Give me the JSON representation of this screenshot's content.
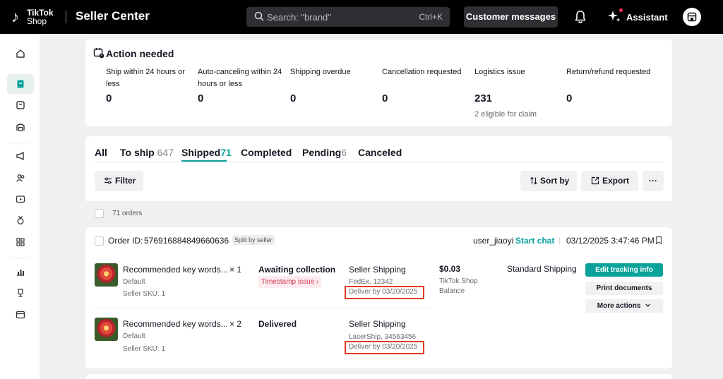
{
  "header": {
    "logo_mark": "♪",
    "logo_text_1": "TikTok",
    "logo_text_2": "Shop",
    "app_title": "Seller Center",
    "search_placeholder": "Search: \"brand\"",
    "search_shortcut": "Ctrl+K",
    "customer_messages": "Customer messages",
    "assistant": "Assistant"
  },
  "sidebar": {
    "items": [
      {
        "icon": "home-icon",
        "active": false
      },
      {
        "icon": "orders-icon",
        "active": true
      },
      {
        "icon": "products-icon",
        "active": false
      },
      {
        "icon": "shipping-icon",
        "active": false
      },
      {
        "icon": "megaphone-icon",
        "active": false
      },
      {
        "icon": "creators-icon",
        "active": false
      },
      {
        "icon": "video-icon",
        "active": false
      },
      {
        "icon": "medal-icon",
        "active": false
      },
      {
        "icon": "apps-icon",
        "active": false
      },
      {
        "icon": "analytics-icon",
        "active": false
      },
      {
        "icon": "trophy-icon",
        "active": false
      },
      {
        "icon": "finance-icon",
        "active": false
      }
    ]
  },
  "action_needed": {
    "title": "Action needed",
    "metrics": [
      {
        "label": "Ship within 24 hours or less",
        "value": "0",
        "sub": ""
      },
      {
        "label": "Auto-canceling within 24 hours or less",
        "value": "0",
        "sub": ""
      },
      {
        "label": "Shipping overdue",
        "value": "0",
        "sub": ""
      },
      {
        "label": "Cancellation requested",
        "value": "0",
        "sub": ""
      },
      {
        "label": "Logistics issue",
        "value": "231",
        "sub": "2 eligible for claim"
      },
      {
        "label": "Return/refund requested",
        "value": "0",
        "sub": ""
      }
    ]
  },
  "tabs": [
    {
      "label": "All",
      "count": ""
    },
    {
      "label": "To ship",
      "count": "647"
    },
    {
      "label": "Shipped",
      "count": "71"
    },
    {
      "label": "Completed",
      "count": ""
    },
    {
      "label": "Pending",
      "count": "6"
    },
    {
      "label": "Canceled",
      "count": ""
    }
  ],
  "toolbar": {
    "filter": "Filter",
    "sort_by": "Sort by",
    "export": "Export",
    "more": "···"
  },
  "orders_count": "71 orders",
  "order": {
    "id_label": "Order ID:",
    "id": "576916884849660636",
    "split_badge": "Split by seller",
    "buyer": "user_jiaoyi",
    "start_chat": "Start chat",
    "time": "03/12/2025 3:47:46 PM",
    "price": "$0.03",
    "payment_1": "TikTok Shop",
    "payment_2": "Balance",
    "shipping_method": "Standard Shipping",
    "actions": {
      "edit_tracking": "Edit tracking info",
      "print_documents": "Print documents",
      "more_actions": "More actions"
    },
    "items": [
      {
        "name": "Recommended key words...",
        "qty": "× 1",
        "variant": "Default",
        "sku": "Seller SKU: 1",
        "status": "Awaiting collection",
        "issue": "Timestamp issue",
        "shipping_title": "Seller Shipping",
        "carrier": "FedEx, 12342",
        "deliver_by": "Deliver by 03/20/2025"
      },
      {
        "name": "Recommended key words...",
        "qty": "× 2",
        "variant": "Default",
        "sku": "Seller SKU: 1",
        "status": "Delivered",
        "issue": "",
        "shipping_title": "Seller Shipping",
        "carrier": "LaserShip, 34563456",
        "deliver_by": "Deliver by 03/20/2025"
      }
    ]
  },
  "colors": {
    "accent": "#0aa39a",
    "highlight_box": "#e33a22",
    "issue_text": "#d2384f"
  }
}
